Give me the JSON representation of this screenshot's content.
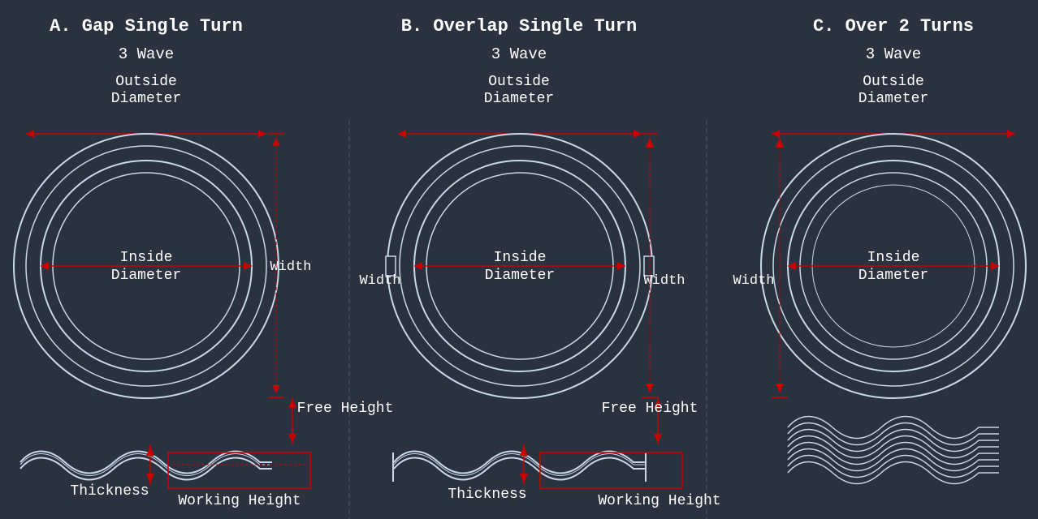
{
  "titles": [
    {
      "label": "A. Gap Single Turn"
    },
    {
      "label": "B. Overlap Single Turn"
    },
    {
      "label": "C. Over 2 Turns"
    }
  ],
  "wave_labels": [
    {
      "label": "3 Wave"
    },
    {
      "label": "3 Wave"
    },
    {
      "label": "3 Wave"
    }
  ],
  "od_labels": [
    {
      "label": "Outside\nDiameter"
    },
    {
      "label": "Outside\nDiameter"
    },
    {
      "label": "Outside\nDiameter"
    }
  ],
  "annotations": {
    "inside_diameter": "Inside\nDiameter",
    "width_a": "Width",
    "width_b": "Width",
    "width_c": "Width",
    "free_height_a": "Free Height",
    "free_height_b": "Free Height",
    "thickness_a": "Thickness",
    "thickness_b": "Thickness",
    "working_height_a": "Working Height",
    "working_height_b": "Working Height"
  },
  "colors": {
    "background": "#2a3240",
    "text": "#ffffff",
    "drawing": "#e0e8f0",
    "red": "#cc0000"
  }
}
